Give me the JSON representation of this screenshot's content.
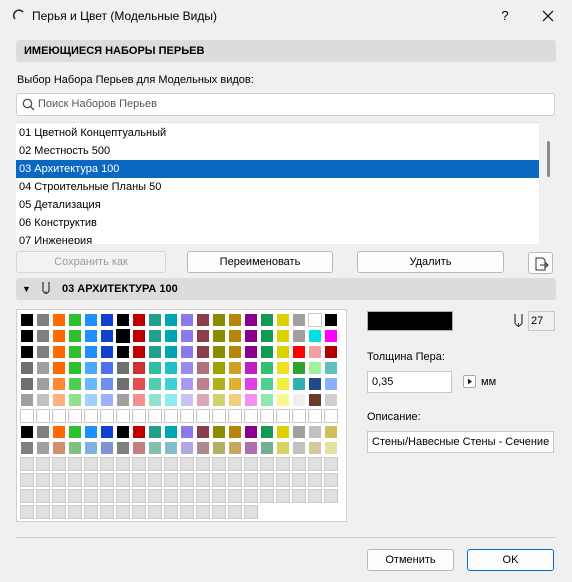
{
  "window": {
    "title": "Перья и Цвет (Модельные Виды)",
    "help_label": "?"
  },
  "sets_section": {
    "header": "ИМЕЮЩИЕСЯ НАБОРЫ ПЕРЬЕВ",
    "select_label": "Выбор Набора Перьев для Модельных видов:",
    "search_placeholder": "Поиск Наборов Перьев",
    "items": [
      "01 Цветной Концептуальный",
      "02 Местность 500",
      "03 Архитектура 100",
      "04 Строительные Планы 50",
      "05 Детализация",
      "06 Конструктив",
      "07 Инженерия"
    ],
    "selected_index": 2,
    "buttons": {
      "save_as": "Сохранить как",
      "rename": "Переименовать",
      "delete": "Удалить"
    }
  },
  "pen_section": {
    "header": "03 АРХИТЕКТУРА 100",
    "current_pen_color": "#000000",
    "pen_number": "27",
    "thickness_label": "Толщина Пера:",
    "thickness_value": "0,35",
    "thickness_unit": "мм",
    "description_label": "Описание:",
    "description_value": "Стены/Навесные Стены - Сечение"
  },
  "palette": {
    "columns": 20,
    "rows": [
      [
        "#000000",
        "#808080",
        "#ff6a00",
        "#2ebf2e",
        "#1e90ff",
        "#1040d0",
        "#000000",
        "#c00000",
        "#1fa08a",
        "#00a7b2",
        "#8a7ae8",
        "#8b3d4a",
        "#8a8a00",
        "#b8860b",
        "#8b008b",
        "#149a55",
        "#e0d000",
        "#a0a0a0",
        "#ffffff",
        "#000000"
      ],
      [
        "#000000",
        "#808080",
        "#ff6a00",
        "#2ebf2e",
        "#1e90ff",
        "#1040d0",
        "#000000",
        "#c00000",
        "#1fa08a",
        "#00a7b2",
        "#8a7ae8",
        "#8b3d4a",
        "#8a8a00",
        "#b8860b",
        "#8b008b",
        "#149a55",
        "#e0d000",
        "#a0a0a0",
        "#00e0e0",
        "#ff00ff"
      ],
      [
        "#000000",
        "#808080",
        "#ff6a00",
        "#2ebf2e",
        "#1e90ff",
        "#1040d0",
        "#000000",
        "#c00000",
        "#1fa08a",
        "#00a7b2",
        "#8a7ae8",
        "#8b3d4a",
        "#8a8a00",
        "#b8860b",
        "#8b008b",
        "#149a55",
        "#e0d000",
        "#ff0000",
        "#f4a0a0",
        "#b00000"
      ],
      [
        "#707070",
        "#a0a0a0",
        "#ff6a00",
        "#2ebf2e",
        "#4aa8ff",
        "#5070f0",
        "#707070",
        "#d03030",
        "#2fbfa0",
        "#20c0c8",
        "#9a8af0",
        "#b07080",
        "#a0a000",
        "#d0a020",
        "#c020c0",
        "#30c070",
        "#f0e020",
        "#30a030",
        "#a0f0a0",
        "#60c0c0"
      ],
      [
        "#707070",
        "#a0a0a0",
        "#ff8a30",
        "#50d050",
        "#6ab8ff",
        "#7090f0",
        "#707070",
        "#e05050",
        "#50d0b0",
        "#40d0d8",
        "#aa9af0",
        "#c08090",
        "#b0b020",
        "#e0b030",
        "#e040e0",
        "#50d090",
        "#f0f040",
        "#30b0b0",
        "#1f4a8a",
        "#8ab0ff"
      ],
      [
        "#a0a0a0",
        "#c0c0c0",
        "#ffb080",
        "#90e090",
        "#a0d0ff",
        "#a0b0ff",
        "#a0a0a0",
        "#f09090",
        "#90e0d0",
        "#90e8f0",
        "#c8c0f8",
        "#d8a8b8",
        "#d0d070",
        "#f0d080",
        "#f090f0",
        "#90e8b0",
        "#f8f890",
        "#f0f0f0",
        "#6a3a2a",
        "#d0d0d0"
      ],
      [
        "#ffffff",
        "#ffffff",
        "#ffffff",
        "#ffffff",
        "#ffffff",
        "#ffffff",
        "#ffffff",
        "#ffffff",
        "#ffffff",
        "#ffffff",
        "#ffffff",
        "#ffffff",
        "#ffffff",
        "#ffffff",
        "#ffffff",
        "#ffffff",
        "#ffffff",
        "#ffffff",
        "#ffffff",
        "#ffffff"
      ],
      [
        "#000000",
        "#808080",
        "#ff6a00",
        "#2ebf2e",
        "#1e90ff",
        "#1040d0",
        "#000000",
        "#c00000",
        "#1fa08a",
        "#00a7b2",
        "#8a7ae8",
        "#8b3d4a",
        "#8a8a00",
        "#b8860b",
        "#8b008b",
        "#149a55",
        "#e0d000",
        "#a0a0a0",
        "#c0c0c0",
        "#d0c060"
      ],
      [
        "#808080",
        "#a0a0a0",
        "#d09070",
        "#80c080",
        "#80b0e0",
        "#8090d0",
        "#808080",
        "#c08080",
        "#80c0b0",
        "#80c0c8",
        "#b0a8e0",
        "#b08890",
        "#b0b060",
        "#c8a860",
        "#b070b0",
        "#70b090",
        "#d8d060",
        "#c0c0c0",
        "#d8c8a0",
        "#e8e0a0"
      ],
      [
        "#e0e0e0",
        "#e0e0e0",
        "#e0e0e0",
        "#e0e0e0",
        "#e0e0e0",
        "#e0e0e0",
        "#e0e0e0",
        "#e0e0e0",
        "#e0e0e0",
        "#e0e0e0",
        "#e0e0e0",
        "#e0e0e0",
        "#e0e0e0",
        "#e0e0e0",
        "#e0e0e0",
        "#e0e0e0",
        "#e0e0e0",
        "#e0e0e0",
        "#e0e0e0",
        "#e0e0e0"
      ],
      [
        "#e0e0e0",
        "#e0e0e0",
        "#e0e0e0",
        "#e0e0e0",
        "#e0e0e0",
        "#e0e0e0",
        "#e0e0e0",
        "#e0e0e0",
        "#e0e0e0",
        "#e0e0e0",
        "#e0e0e0",
        "#e0e0e0",
        "#e0e0e0",
        "#e0e0e0",
        "#e0e0e0",
        "#e0e0e0",
        "#e0e0e0",
        "#e0e0e0",
        "#e0e0e0",
        "#e0e0e0"
      ],
      [
        "#e0e0e0",
        "#e0e0e0",
        "#e0e0e0",
        "#e0e0e0",
        "#e0e0e0",
        "#e0e0e0",
        "#e0e0e0",
        "#e0e0e0",
        "#e0e0e0",
        "#e0e0e0",
        "#e0e0e0",
        "#e0e0e0",
        "#e0e0e0",
        "#e0e0e0",
        "#e0e0e0",
        "#e0e0e0",
        "#e0e0e0",
        "#e0e0e0",
        "#e0e0e0",
        "#e0e0e0"
      ],
      [
        "#e0e0e0",
        "#e0e0e0",
        "#e0e0e0",
        "#e0e0e0",
        "#e0e0e0",
        "#e0e0e0",
        "#e0e0e0",
        "#e0e0e0",
        "#e0e0e0",
        "#e0e0e0",
        "#e0e0e0",
        "#e0e0e0",
        "#e0e0e0",
        "#e0e0e0",
        "#e0e0e0",
        "#e0e0e0",
        "#e0e0e0",
        "#e0e0e0",
        "#e0e0e0",
        "#e0e0e0"
      ]
    ],
    "selected_cell": [
      1,
      6
    ]
  },
  "footer": {
    "cancel": "Отменить",
    "ok": "OK"
  },
  "colors": {
    "selection": "#0a67c2",
    "accent_border": "#0a67c2"
  }
}
